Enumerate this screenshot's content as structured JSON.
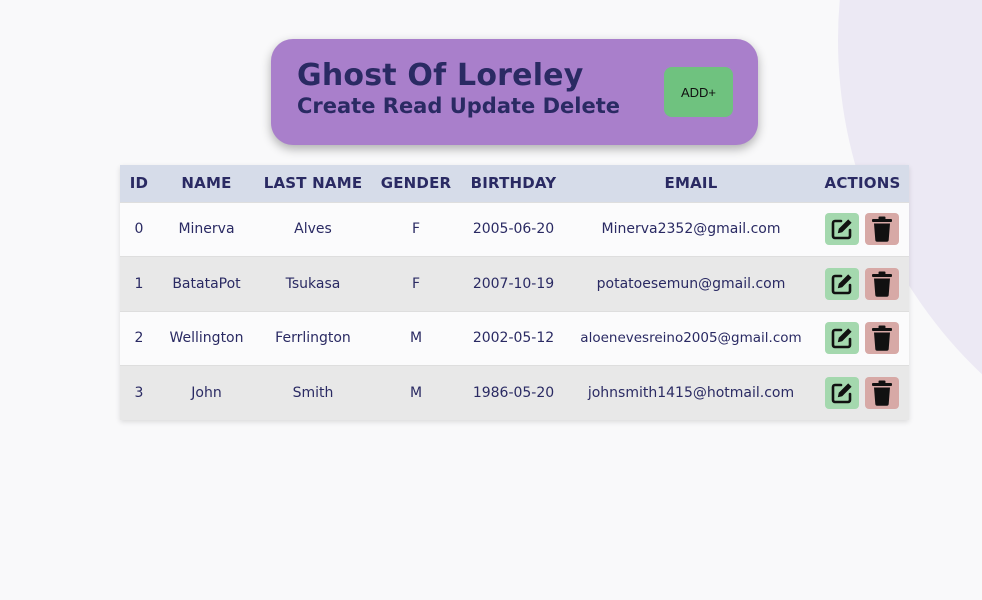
{
  "header": {
    "title": "Ghost Of Loreley",
    "subtitle": "Create Read Update Delete",
    "add_label": "ADD+"
  },
  "table": {
    "columns": [
      "ID",
      "NAME",
      "LAST NAME",
      "GENDER",
      "BIRTHDAY",
      "EMAIL",
      "ACTIONS"
    ],
    "rows": [
      {
        "id": "0",
        "name": "Minerva",
        "last_name": "Alves",
        "gender": "F",
        "birthday": "2005-06-20",
        "email": "Minerva2352@gmail.com"
      },
      {
        "id": "1",
        "name": "BatataPot",
        "last_name": "Tsukasa",
        "gender": "F",
        "birthday": "2007-10-19",
        "email": "potatoesemun@gmail.com"
      },
      {
        "id": "2",
        "name": "Wellington",
        "last_name": "Ferrlington",
        "gender": "M",
        "birthday": "2002-05-12",
        "email": "aloenevesreino2005@gmail.com"
      },
      {
        "id": "3",
        "name": "John",
        "last_name": "Smith",
        "gender": "M",
        "birthday": "1986-05-20",
        "email": "johnsmith1415@hotmail.com"
      }
    ]
  },
  "icons": {
    "edit": "edit-icon",
    "delete": "trash-icon"
  },
  "colors": {
    "header_card": "#a97fcb",
    "text": "#2a2a63",
    "add_button": "#6fc27f",
    "edit_button": "#a4d8ae",
    "delete_button": "#d7a9a6",
    "table_header": "#d6dce9"
  }
}
